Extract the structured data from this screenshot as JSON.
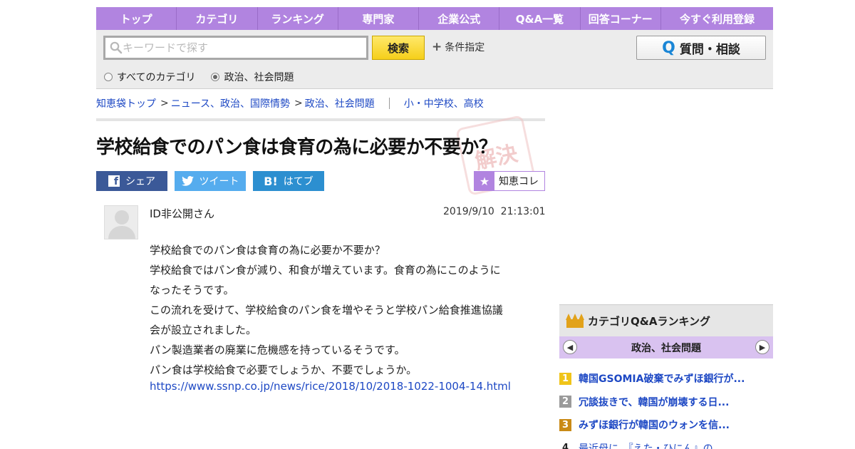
{
  "nav": {
    "items": [
      {
        "label": "トップ"
      },
      {
        "label": "カテゴリ"
      },
      {
        "label": "ランキング"
      },
      {
        "label": "専門家"
      },
      {
        "label": "企業公式"
      },
      {
        "label": "Q&A一覧"
      },
      {
        "label": "回答コーナー"
      },
      {
        "label": "今すぐ利用登録"
      }
    ]
  },
  "search": {
    "placeholder": "キーワードで探す",
    "button_label": "検索",
    "condition_label": "条件指定",
    "ask_label": "質問・相談",
    "ask_icon": "Q",
    "scope_options": [
      {
        "label": "すべてのカテゴリ",
        "selected": false
      },
      {
        "label": "政治、社会問題",
        "selected": true
      }
    ]
  },
  "breadcrumb": {
    "home": "知恵袋トップ",
    "level1": "ニュース、政治、国際情勢",
    "level2": "政治、社会問題",
    "related": "小・中学校、高校"
  },
  "question": {
    "title": "学校給食でのパン食は食育の為に必要か不要か？",
    "stamp": "解決",
    "share": {
      "facebook": "シェア",
      "twitter": "ツイート",
      "hatena": "はてブ",
      "hatena_icon": "B!"
    },
    "collection_label": "知恵コレ",
    "asker": "ID非公開さん",
    "posted_at": "2019/9/10  21:13:01",
    "body_lines": [
      "学校給食でのパン食は食育の為に必要か不要か？",
      "学校給食ではパン食が減り、和食が増えています。食育の為にこのように",
      "なったそうです。",
      "この流れを受けて、学校給食のパン食を増やそうと学校パン給食推進協議",
      "会が設立されました。",
      "パン製造業者の廃業に危機感を持っているそうです。",
      "パン食は学校給食で必要でしょうか、不要でしょうか。"
    ],
    "link": "https://www.ssnp.co.jp/news/rice/2018/10/2018-1022-1004-14.html"
  },
  "ranking": {
    "title": "カテゴリQ&Aランキング",
    "category": "政治、社会問題",
    "items": [
      {
        "rank": "1",
        "text": "韓国GSOMIA破棄でみずほ銀行が..."
      },
      {
        "rank": "2",
        "text": "冗談抜きで、韓国が崩壊する日..."
      },
      {
        "rank": "3",
        "text": "みずほ銀行が韓国のウォンを信..."
      },
      {
        "rank": "4",
        "text": "最近母に、『えた・ひにん』の..."
      }
    ]
  },
  "colors": {
    "nav_purple": "#b184e0",
    "search_yellow": "#f5cf1a",
    "link_blue": "#1d48c4",
    "facebook": "#3b5998",
    "twitter": "#55acee",
    "hatena": "#2c8fd0"
  }
}
